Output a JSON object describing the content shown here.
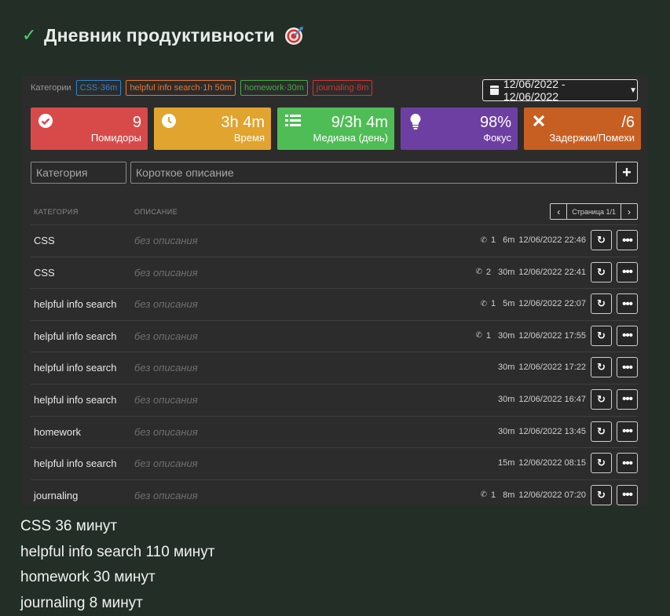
{
  "header": {
    "title": "Дневник продуктивности"
  },
  "categories_label": "Категории",
  "chips": [
    {
      "text": "CSS·36m",
      "color": "#2e86d1"
    },
    {
      "text": "helpful info search·1h 50m",
      "color": "#e8762a"
    },
    {
      "text": "homework·30m",
      "color": "#3fae3f"
    },
    {
      "text": "journaling·8m",
      "color": "#d8322e"
    }
  ],
  "date_range": "12/06/2022 - 12/06/2022",
  "stats": [
    {
      "value": "9",
      "label": "Помидоры",
      "color": "#d84a4a",
      "icon": "check-circle-icon"
    },
    {
      "value": "3h 4m",
      "label": "Время",
      "color": "#e1a42f",
      "icon": "clock-icon"
    },
    {
      "value": "9/3h 4m",
      "label": "Медиана (день)",
      "color": "#4fbd55",
      "icon": "list-icon"
    },
    {
      "value": "98%",
      "label": "Фокус",
      "color": "#6e3fa2",
      "icon": "lightbulb-icon"
    },
    {
      "value": "/6",
      "label": "Задержки/Помехи",
      "color": "#c85f22",
      "icon": "close-icon"
    }
  ],
  "form": {
    "category_placeholder": "Категория",
    "description_placeholder": "Короткое описание"
  },
  "table": {
    "col_category": "КАТЕГОРИЯ",
    "col_description": "ОПИСАНИЕ",
    "page_label": "Страница 1/1",
    "rows": [
      {
        "category": "CSS",
        "description": "без описания",
        "calls": "1",
        "duration": "6m",
        "timestamp": "12/06/2022 22:46"
      },
      {
        "category": "CSS",
        "description": "без описания",
        "calls": "2",
        "duration": "30m",
        "timestamp": "12/06/2022 22:41"
      },
      {
        "category": "helpful info search",
        "description": "без описания",
        "calls": "1",
        "duration": "5m",
        "timestamp": "12/06/2022 22:07"
      },
      {
        "category": "helpful info search",
        "description": "без описания",
        "calls": "1",
        "duration": "30m",
        "timestamp": "12/06/2022 17:55"
      },
      {
        "category": "helpful info search",
        "description": "без описания",
        "calls": "",
        "duration": "30m",
        "timestamp": "12/06/2022 17:22"
      },
      {
        "category": "helpful info search",
        "description": "без описания",
        "calls": "",
        "duration": "30m",
        "timestamp": "12/06/2022 16:47"
      },
      {
        "category": "homework",
        "description": "без описания",
        "calls": "",
        "duration": "30m",
        "timestamp": "12/06/2022 13:45"
      },
      {
        "category": "helpful info search",
        "description": "без описания",
        "calls": "",
        "duration": "15m",
        "timestamp": "12/06/2022 08:15"
      },
      {
        "category": "journaling",
        "description": "без описания",
        "calls": "1",
        "duration": "8m",
        "timestamp": "12/06/2022 07:20"
      }
    ]
  },
  "summary": [
    "CSS 36 минут",
    "helpful info search 110 минут",
    "homework 30 минут",
    "journaling 8 минут"
  ]
}
